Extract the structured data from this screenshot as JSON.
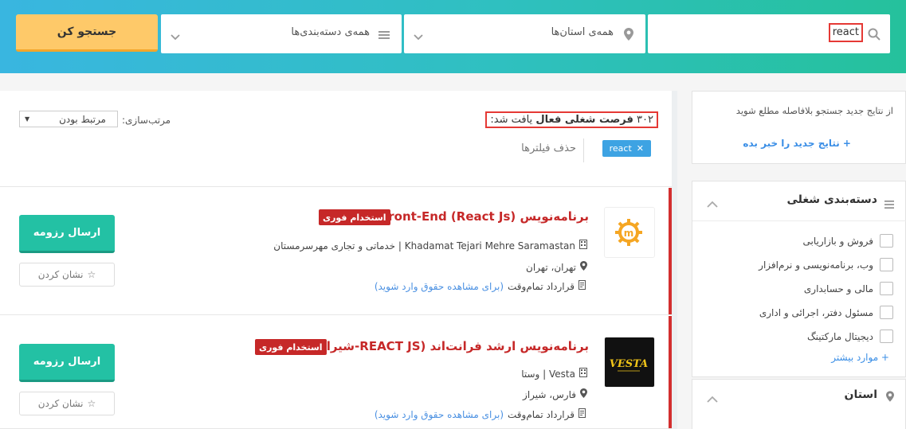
{
  "header": {
    "search_value": "react",
    "province_label": "همه‌ی استان‌ها",
    "category_label": "همه‌ی دسته‌بندی‌ها",
    "search_button": "جستجو کن"
  },
  "results": {
    "count_number": "۳۰۲",
    "count_bold": "فرصت شغلی فعال",
    "count_suffix": "یافت شد:",
    "sort_label": "مرتب‌سازی:",
    "sort_value": "مرتبط بودن",
    "filter_chip": "react",
    "clear_filters": "حذف فیلترها"
  },
  "jobs": [
    {
      "title": "برنامه‌نویس Front-End (React Js)",
      "urgent": "استخدام فوری",
      "company": "Khadamat Tejari Mehre Saramastan | خدماتی و تجاری مهرسرمستان",
      "location": "تهران، تهران",
      "contract": "قرارداد تمام‌وقت",
      "login_note": "(برای مشاهده حقوق وارد شوید)",
      "apply": "ارسال رزومه",
      "bookmark": "نشان کردن",
      "logo_letter": "m",
      "logo_color": "#f5a623"
    },
    {
      "title": "برنامه‌نویس ارشد فرانت‌اند (REACT JS-شیراز)",
      "urgent": "استخدام فوری",
      "company": "Vesta | وستا",
      "location": "فارس، شیراز",
      "contract": "قرارداد تمام‌وقت",
      "login_note": "(برای مشاهده حقوق وارد شوید)",
      "apply": "ارسال رزومه",
      "bookmark": "نشان کردن",
      "logo_letter": "VESTA",
      "logo_color": "#f0c419"
    }
  ],
  "sidebar": {
    "alert_text": "از نتایج جدید جستجو بلافاصله مطلع شوید",
    "alert_link": "+ نتایج جدید را خبر بده",
    "category_title": "دسته‌بندی شغلی",
    "categories": [
      "فروش و بازاریابی",
      "وب، برنامه‌نویسی و نرم‌افزار",
      "مالی و حسابداری",
      "مسئول دفتر، اجرائی و اداری",
      "دیجیتال مارکتینگ"
    ],
    "more_link": "+ موارد بیشتر",
    "province_title": "استان"
  },
  "colors": {
    "accent_red": "#c62828",
    "apply_green": "#23c1a4",
    "search_yellow": "#fec969",
    "link_blue": "#3a8ee6"
  }
}
